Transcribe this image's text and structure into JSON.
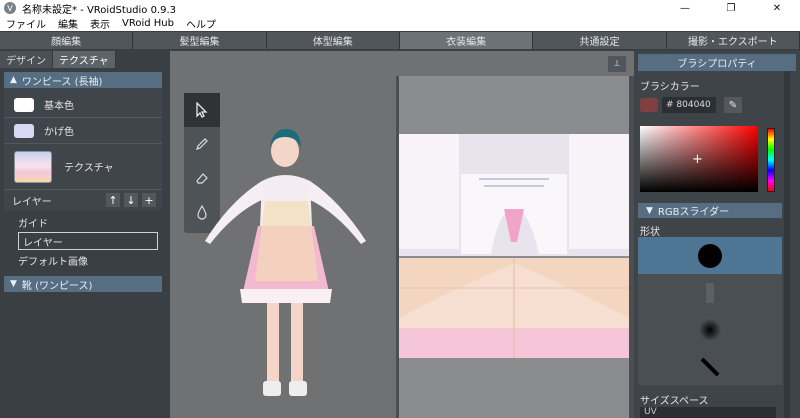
{
  "window": {
    "title": "名称未設定* - VRoidStudio 0.9.3",
    "minimize": "—",
    "maximize": "❐",
    "close": "✕"
  },
  "menu": [
    "ファイル",
    "編集",
    "表示",
    "VRoid Hub",
    "ヘルプ"
  ],
  "main_tabs": [
    "顔編集",
    "髪型編集",
    "体型編集",
    "衣装編集",
    "共通設定",
    "撮影・エクスポート"
  ],
  "main_tabs_active": 3,
  "left": {
    "subtabs": [
      "デザイン",
      "テクスチャ"
    ],
    "section1": "ワンピース (長袖)",
    "base_color": "基本色",
    "shade_color": "かげ色",
    "texture": "テクスチャ",
    "layer_label": "レイヤー",
    "layers": [
      "ガイド",
      "レイヤー",
      "デフォルト画像"
    ],
    "section2": "靴 (ワンピース)",
    "base_color_hex": "#ffffff",
    "shade_color_hex": "#d8d8f5"
  },
  "right": {
    "header": "ブラシプロパティ",
    "brush_color_label": "ブラシカラー",
    "hex": "# 804040",
    "color_hex": "#804040",
    "rgb_slider": "RGBスライダー",
    "shape_label": "形状",
    "size_space_label": "サイズスペース",
    "size_space_value": "UV"
  },
  "icons": {
    "cursor": "cursor-icon",
    "pen": "pen-icon",
    "eraser": "eraser-icon",
    "fill": "fill-icon"
  }
}
